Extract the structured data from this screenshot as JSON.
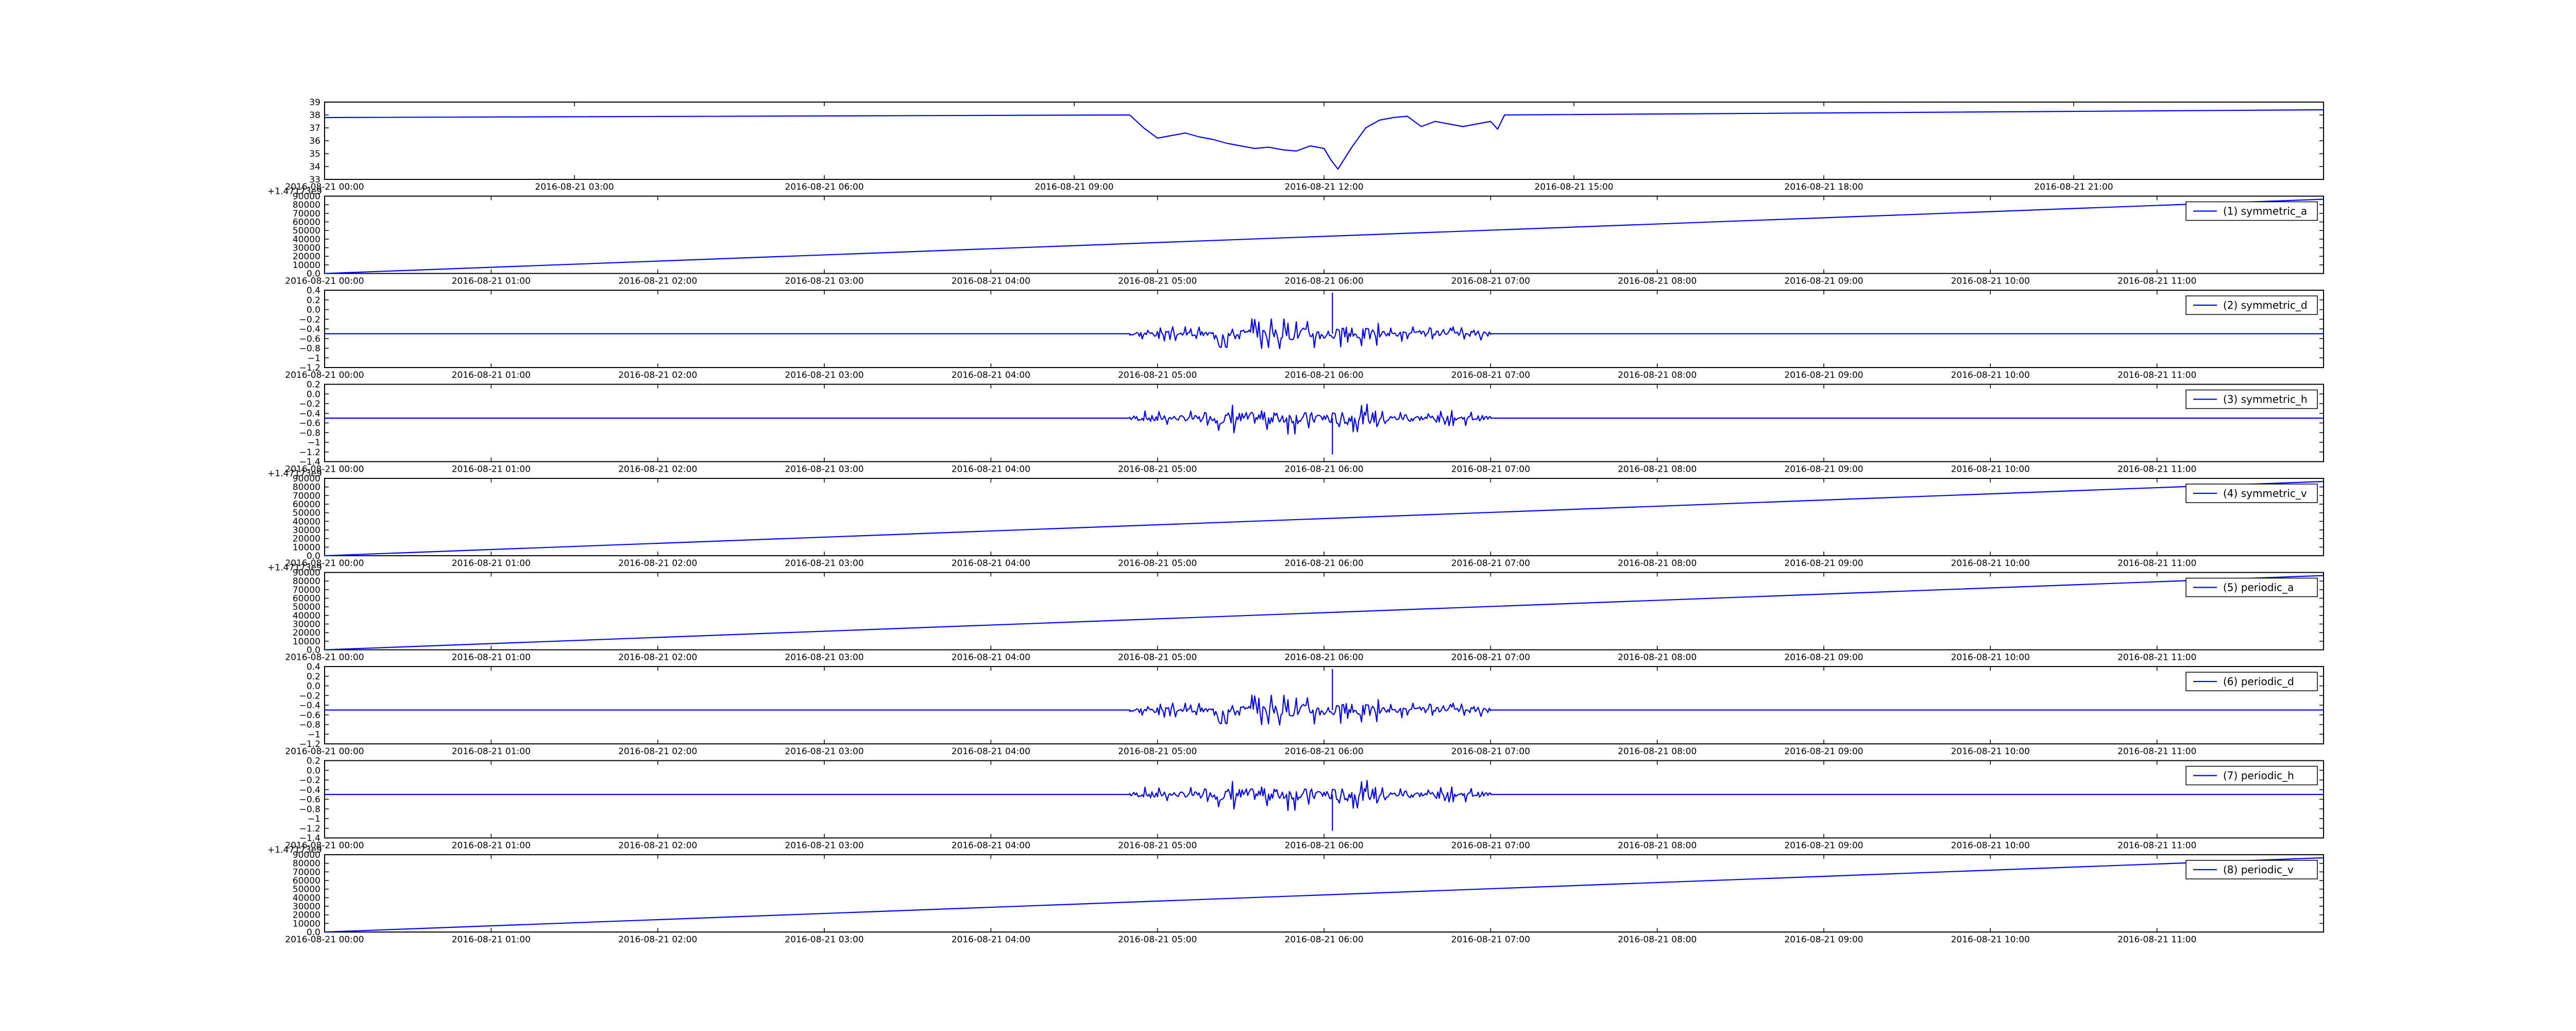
{
  "chart_data": [
    {
      "type": "line",
      "x_axis": "datetime",
      "xlim": [
        "2016-08-21 00:00",
        "2016-08-21 24:00"
      ],
      "ylim": [
        33,
        39
      ],
      "yticks": [
        33,
        34,
        35,
        36,
        37,
        38,
        39
      ],
      "xticks": [
        "2016-08-21 00:00",
        "2016-08-21 03:00",
        "2016-08-21 06:00",
        "2016-08-21 09:00",
        "2016-08-21 12:00",
        "2016-08-21 15:00",
        "2016-08-21 18:00",
        "2016-08-21 21:00"
      ],
      "legend": null,
      "offset_label": "",
      "color": "#0000ff",
      "series": [
        {
          "x": [
            "2016-08-21 00:00",
            "2016-08-21 09:40",
            "2016-08-21 09:50",
            "2016-08-21 10:00",
            "2016-08-21 10:10",
            "2016-08-21 10:20",
            "2016-08-21 10:30",
            "2016-08-21 10:40",
            "2016-08-21 10:50",
            "2016-08-21 11:00",
            "2016-08-21 11:10",
            "2016-08-21 11:20",
            "2016-08-21 11:30",
            "2016-08-21 11:40",
            "2016-08-21 11:50",
            "2016-08-21 12:00",
            "2016-08-21 12:05",
            "2016-08-21 12:10",
            "2016-08-21 12:20",
            "2016-08-21 12:30",
            "2016-08-21 12:40",
            "2016-08-21 12:50",
            "2016-08-21 13:00",
            "2016-08-21 13:10",
            "2016-08-21 13:20",
            "2016-08-21 13:30",
            "2016-08-21 13:40",
            "2016-08-21 13:50",
            "2016-08-21 14:00",
            "2016-08-21 14:05",
            "2016-08-21 14:10",
            "2016-08-21 24:00"
          ],
          "y": [
            37.8,
            38.0,
            37.0,
            36.2,
            36.4,
            36.6,
            36.3,
            36.1,
            35.8,
            35.6,
            35.4,
            35.5,
            35.3,
            35.2,
            35.6,
            35.4,
            34.5,
            33.8,
            35.5,
            37.0,
            37.6,
            37.8,
            37.9,
            37.1,
            37.5,
            37.3,
            37.1,
            37.3,
            37.5,
            36.9,
            38.0,
            38.4
          ]
        }
      ]
    },
    {
      "type": "line",
      "x_axis": "datetime",
      "xlim": [
        "2016-08-21 00:00",
        "2016-08-21 12:00"
      ],
      "ylim": [
        0,
        90000
      ],
      "yticks": [
        0,
        10000,
        20000,
        30000,
        40000,
        50000,
        60000,
        70000,
        80000,
        90000
      ],
      "xticks": [
        "2016-08-21 00:00",
        "2016-08-21 01:00",
        "2016-08-21 02:00",
        "2016-08-21 03:00",
        "2016-08-21 04:00",
        "2016-08-21 05:00",
        "2016-08-21 06:00",
        "2016-08-21 07:00",
        "2016-08-21 08:00",
        "2016-08-21 09:00",
        "2016-08-21 10:00",
        "2016-08-21 11:00"
      ],
      "legend": "(1) symmetric_a",
      "offset_label": "+1.47173e9",
      "color": "#0000ff",
      "series": [
        {
          "name": "(1) symmetric_a",
          "x": [
            "2016-08-21 00:00",
            "2016-08-21 12:00"
          ],
          "y": [
            0,
            86400
          ]
        }
      ]
    },
    {
      "type": "line",
      "x_axis": "datetime",
      "xlim": [
        "2016-08-21 00:00",
        "2016-08-21 12:00"
      ],
      "ylim": [
        -1.2,
        0.4
      ],
      "yticks": [
        -1.2,
        -1.0,
        -0.8,
        -0.6,
        -0.4,
        -0.2,
        0.0,
        0.2,
        0.4
      ],
      "xticks": [
        "2016-08-21 00:00",
        "2016-08-21 01:00",
        "2016-08-21 02:00",
        "2016-08-21 03:00",
        "2016-08-21 04:00",
        "2016-08-21 05:00",
        "2016-08-21 06:00",
        "2016-08-21 07:00",
        "2016-08-21 08:00",
        "2016-08-21 09:00",
        "2016-08-21 10:00",
        "2016-08-21 11:00"
      ],
      "legend": "(2) symmetric_d",
      "offset_label": "",
      "color": "#0000ff",
      "baseline": -0.5,
      "noise": {
        "start": "2016-08-21 04:50",
        "end": "2016-08-21 07:00",
        "amplitude": 0.35,
        "seed": 3
      },
      "series": [
        {
          "name": "(2) symmetric_d",
          "x": [
            "2016-08-21 00:00",
            "2016-08-21 04:50",
            "2016-08-21 05:25",
            "2016-08-21 06:00",
            "2016-08-21 06:30",
            "2016-08-21 06:50",
            "2016-08-21 07:00",
            "2016-08-21 12:00"
          ],
          "y": [
            -0.5,
            -0.5,
            -0.5,
            -0.5,
            -0.5,
            -0.5,
            -0.5,
            -0.5
          ]
        }
      ],
      "spike": {
        "x": "2016-08-21 06:03",
        "y": 0.35
      }
    },
    {
      "type": "line",
      "x_axis": "datetime",
      "xlim": [
        "2016-08-21 00:00",
        "2016-08-21 12:00"
      ],
      "ylim": [
        -1.4,
        0.2
      ],
      "yticks": [
        -1.4,
        -1.2,
        -1.0,
        -0.8,
        -0.6,
        -0.4,
        -0.2,
        0.0,
        0.2
      ],
      "xticks": [
        "2016-08-21 00:00",
        "2016-08-21 01:00",
        "2016-08-21 02:00",
        "2016-08-21 03:00",
        "2016-08-21 04:00",
        "2016-08-21 05:00",
        "2016-08-21 06:00",
        "2016-08-21 07:00",
        "2016-08-21 08:00",
        "2016-08-21 09:00",
        "2016-08-21 10:00",
        "2016-08-21 11:00"
      ],
      "legend": "(3) symmetric_h",
      "offset_label": "",
      "color": "#0000ff",
      "baseline": -0.5,
      "noise": {
        "start": "2016-08-21 04:50",
        "end": "2016-08-21 07:00",
        "amplitude": 0.35,
        "seed": 7
      },
      "series": [
        {
          "name": "(3) symmetric_h",
          "x": [
            "2016-08-21 00:00",
            "2016-08-21 12:00"
          ],
          "y": [
            -0.5,
            -0.5
          ]
        }
      ],
      "spike": {
        "x": "2016-08-21 06:03",
        "y": -1.25
      }
    },
    {
      "type": "line",
      "x_axis": "datetime",
      "xlim": [
        "2016-08-21 00:00",
        "2016-08-21 12:00"
      ],
      "ylim": [
        0,
        90000
      ],
      "yticks": [
        0,
        10000,
        20000,
        30000,
        40000,
        50000,
        60000,
        70000,
        80000,
        90000
      ],
      "xticks": [
        "2016-08-21 00:00",
        "2016-08-21 01:00",
        "2016-08-21 02:00",
        "2016-08-21 03:00",
        "2016-08-21 04:00",
        "2016-08-21 05:00",
        "2016-08-21 06:00",
        "2016-08-21 07:00",
        "2016-08-21 08:00",
        "2016-08-21 09:00",
        "2016-08-21 10:00",
        "2016-08-21 11:00"
      ],
      "legend": "(4) symmetric_v",
      "offset_label": "+1.47173e9",
      "color": "#0000ff",
      "series": [
        {
          "name": "(4) symmetric_v",
          "x": [
            "2016-08-21 00:00",
            "2016-08-21 12:00"
          ],
          "y": [
            0,
            86400
          ]
        }
      ]
    },
    {
      "type": "line",
      "x_axis": "datetime",
      "xlim": [
        "2016-08-21 00:00",
        "2016-08-21 12:00"
      ],
      "ylim": [
        0,
        90000
      ],
      "yticks": [
        0,
        10000,
        20000,
        30000,
        40000,
        50000,
        60000,
        70000,
        80000,
        90000
      ],
      "xticks": [
        "2016-08-21 00:00",
        "2016-08-21 01:00",
        "2016-08-21 02:00",
        "2016-08-21 03:00",
        "2016-08-21 04:00",
        "2016-08-21 05:00",
        "2016-08-21 06:00",
        "2016-08-21 07:00",
        "2016-08-21 08:00",
        "2016-08-21 09:00",
        "2016-08-21 10:00",
        "2016-08-21 11:00"
      ],
      "legend": "(5) periodic_a",
      "offset_label": "+1.47173e9",
      "color": "#0000ff",
      "series": [
        {
          "name": "(5) periodic_a",
          "x": [
            "2016-08-21 00:00",
            "2016-08-21 12:00"
          ],
          "y": [
            0,
            86400
          ]
        }
      ]
    },
    {
      "type": "line",
      "x_axis": "datetime",
      "xlim": [
        "2016-08-21 00:00",
        "2016-08-21 12:00"
      ],
      "ylim": [
        -1.2,
        0.4
      ],
      "yticks": [
        -1.2,
        -1.0,
        -0.8,
        -0.6,
        -0.4,
        -0.2,
        0.0,
        0.2,
        0.4
      ],
      "xticks": [
        "2016-08-21 00:00",
        "2016-08-21 01:00",
        "2016-08-21 02:00",
        "2016-08-21 03:00",
        "2016-08-21 04:00",
        "2016-08-21 05:00",
        "2016-08-21 06:00",
        "2016-08-21 07:00",
        "2016-08-21 08:00",
        "2016-08-21 09:00",
        "2016-08-21 10:00",
        "2016-08-21 11:00"
      ],
      "legend": "(6) periodic_d",
      "offset_label": "",
      "color": "#0000ff",
      "baseline": -0.5,
      "noise": {
        "start": "2016-08-21 04:50",
        "end": "2016-08-21 07:00",
        "amplitude": 0.35,
        "seed": 3
      },
      "series": [
        {
          "name": "(6) periodic_d",
          "x": [
            "2016-08-21 00:00",
            "2016-08-21 12:00"
          ],
          "y": [
            -0.5,
            -0.5
          ]
        }
      ],
      "spike": {
        "x": "2016-08-21 06:03",
        "y": 0.35
      }
    },
    {
      "type": "line",
      "x_axis": "datetime",
      "xlim": [
        "2016-08-21 00:00",
        "2016-08-21 12:00"
      ],
      "ylim": [
        -1.4,
        0.2
      ],
      "yticks": [
        -1.4,
        -1.2,
        -1.0,
        -0.8,
        -0.6,
        -0.4,
        -0.2,
        0.0,
        0.2
      ],
      "xticks": [
        "2016-08-21 00:00",
        "2016-08-21 01:00",
        "2016-08-21 02:00",
        "2016-08-21 03:00",
        "2016-08-21 04:00",
        "2016-08-21 05:00",
        "2016-08-21 06:00",
        "2016-08-21 07:00",
        "2016-08-21 08:00",
        "2016-08-21 09:00",
        "2016-08-21 10:00",
        "2016-08-21 11:00"
      ],
      "legend": "(7) periodic_h",
      "offset_label": "",
      "color": "#0000ff",
      "baseline": -0.5,
      "noise": {
        "start": "2016-08-21 04:50",
        "end": "2016-08-21 07:00",
        "amplitude": 0.35,
        "seed": 7
      },
      "series": [
        {
          "name": "(7) periodic_h",
          "x": [
            "2016-08-21 00:00",
            "2016-08-21 12:00"
          ],
          "y": [
            -0.5,
            -0.5
          ]
        }
      ],
      "spike": {
        "x": "2016-08-21 06:03",
        "y": -1.25
      }
    },
    {
      "type": "line",
      "x_axis": "datetime",
      "xlim": [
        "2016-08-21 00:00",
        "2016-08-21 12:00"
      ],
      "ylim": [
        0,
        90000
      ],
      "yticks": [
        0,
        10000,
        20000,
        30000,
        40000,
        50000,
        60000,
        70000,
        80000,
        90000
      ],
      "xticks": [
        "2016-08-21 00:00",
        "2016-08-21 01:00",
        "2016-08-21 02:00",
        "2016-08-21 03:00",
        "2016-08-21 04:00",
        "2016-08-21 05:00",
        "2016-08-21 06:00",
        "2016-08-21 07:00",
        "2016-08-21 08:00",
        "2016-08-21 09:00",
        "2016-08-21 10:00",
        "2016-08-21 11:00"
      ],
      "legend": "(8) periodic_v",
      "offset_label": "+1.47173e9",
      "color": "#0000ff",
      "series": [
        {
          "name": "(8) periodic_v",
          "x": [
            "2016-08-21 00:00",
            "2016-08-21 12:00"
          ],
          "y": [
            0,
            86400
          ]
        }
      ]
    }
  ]
}
